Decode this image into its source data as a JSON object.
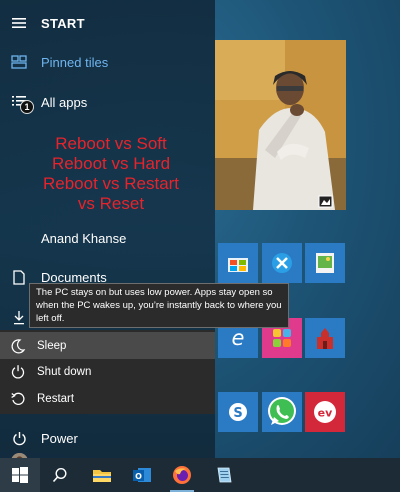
{
  "start": {
    "title": "START"
  },
  "pane": {
    "pinned_tiles": "Pinned tiles",
    "all_apps": "All apps",
    "all_apps_badge": "1",
    "user_name": "Anand Khanse",
    "documents": "Documents",
    "power": "Power"
  },
  "overlay": {
    "lines": [
      "Reboot vs Soft",
      "Reboot vs Hard",
      "Reboot vs Restart",
      "vs Reset"
    ]
  },
  "tooltip": {
    "text": "The PC stays on but uses low power. Apps stay open so when the PC wakes up, you’re instantly back to where you left off."
  },
  "power_menu": {
    "sleep": "Sleep",
    "shut_down": "Shut down",
    "restart": "Restart"
  },
  "colors": {
    "accent": "#6fb5ef",
    "overlay_red": "#e8232b",
    "menu_bg": "#2b2b2b",
    "menu_selected": "#4a4a4a",
    "taskbar": "#1c2b36"
  },
  "icons": {
    "hamburger": "hamburger-menu-icon",
    "pinned": "pinned-tiles-icon",
    "all_apps": "all-apps-list-icon",
    "documents": "document-icon",
    "downloads": "download-icon",
    "sleep": "moon-icon",
    "shut_down": "power-icon",
    "restart": "restart-icon",
    "power": "power-icon",
    "windows": "windows-logo-icon",
    "search": "search-icon",
    "explorer": "folder-icon",
    "outlook": "outlook-icon",
    "firefox": "firefox-icon",
    "notepad": "notepad-icon"
  }
}
